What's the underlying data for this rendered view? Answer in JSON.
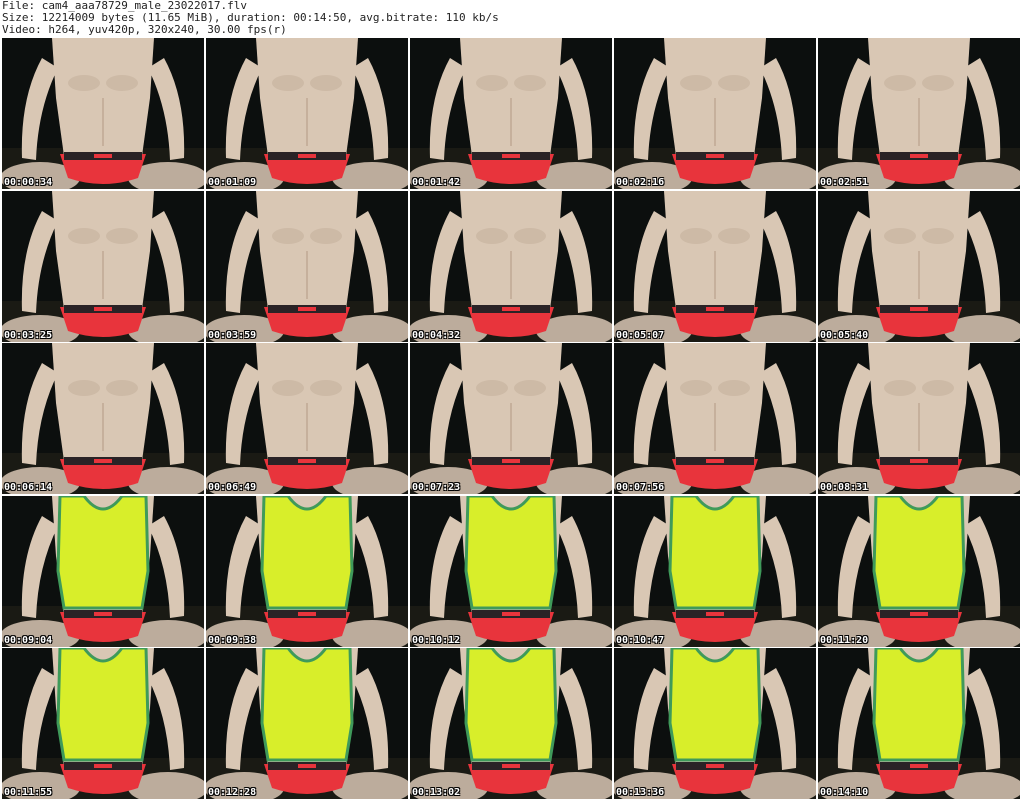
{
  "header": {
    "file_line": "File: cam4_aaa78729_male_23022017.flv",
    "size_line": "Size: 12214009 bytes (11.65 MiB), duration: 00:14:50, avg.bitrate: 110 kb/s",
    "video_line": "Video: h264, yuv420p, 320x240, 30.00 fps(r)"
  },
  "thumbnails": [
    {
      "timestamp": "00:00:34",
      "shirt": "none"
    },
    {
      "timestamp": "00:01:09",
      "shirt": "none"
    },
    {
      "timestamp": "00:01:42",
      "shirt": "none"
    },
    {
      "timestamp": "00:02:16",
      "shirt": "none"
    },
    {
      "timestamp": "00:02:51",
      "shirt": "none"
    },
    {
      "timestamp": "00:03:25",
      "shirt": "none"
    },
    {
      "timestamp": "00:03:59",
      "shirt": "none"
    },
    {
      "timestamp": "00:04:32",
      "shirt": "none"
    },
    {
      "timestamp": "00:05:07",
      "shirt": "none"
    },
    {
      "timestamp": "00:05:40",
      "shirt": "none"
    },
    {
      "timestamp": "00:06:14",
      "shirt": "none"
    },
    {
      "timestamp": "00:06:49",
      "shirt": "none"
    },
    {
      "timestamp": "00:07:23",
      "shirt": "none"
    },
    {
      "timestamp": "00:07:56",
      "shirt": "none"
    },
    {
      "timestamp": "00:08:31",
      "shirt": "none"
    },
    {
      "timestamp": "00:09:04",
      "shirt": "yellow-tank"
    },
    {
      "timestamp": "00:09:38",
      "shirt": "yellow-tank"
    },
    {
      "timestamp": "00:10:12",
      "shirt": "yellow-tank"
    },
    {
      "timestamp": "00:10:47",
      "shirt": "yellow-tank"
    },
    {
      "timestamp": "00:11:20",
      "shirt": "yellow-tank"
    },
    {
      "timestamp": "00:11:55",
      "shirt": "yellow-tank"
    },
    {
      "timestamp": "00:12:28",
      "shirt": "yellow-tank"
    },
    {
      "timestamp": "00:13:02",
      "shirt": "yellow-tank"
    },
    {
      "timestamp": "00:13:36",
      "shirt": "yellow-tank"
    },
    {
      "timestamp": "00:14:10",
      "shirt": "yellow-tank"
    }
  ],
  "colors": {
    "background": "#0c0f0e",
    "skin": "#d9c7b4",
    "briefs": "#e8343c",
    "waistband": "#2a2326",
    "tank": "#d8ee2a",
    "tank_trim": "#3f9a5a"
  }
}
